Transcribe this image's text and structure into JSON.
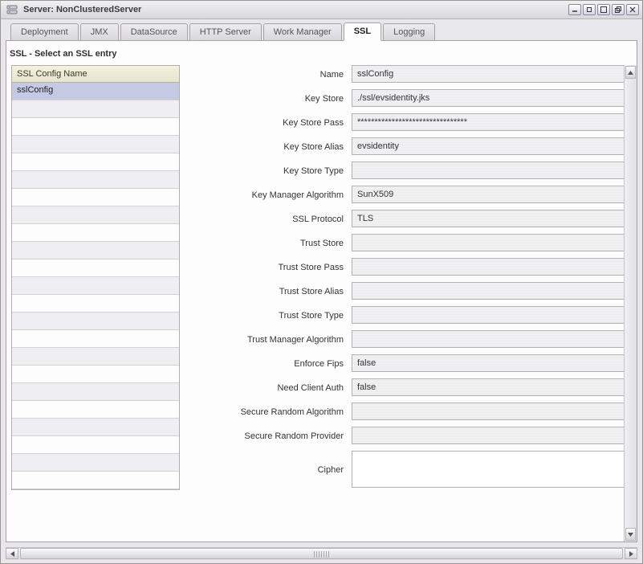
{
  "window": {
    "title": "Server: NonClusteredServer"
  },
  "tabs": [
    {
      "label": "Deployment",
      "active": false
    },
    {
      "label": "JMX",
      "active": false
    },
    {
      "label": "DataSource",
      "active": false
    },
    {
      "label": "HTTP Server",
      "active": false
    },
    {
      "label": "Work Manager",
      "active": false
    },
    {
      "label": "SSL",
      "active": true
    },
    {
      "label": "Logging",
      "active": false
    }
  ],
  "section": {
    "title": "SSL - Select an SSL entry"
  },
  "list": {
    "header": "SSL Config Name",
    "items": [
      "sslConfig"
    ],
    "selected_index": 0,
    "visible_rows": 23
  },
  "form": {
    "fields": [
      {
        "label": "Name",
        "value": "sslConfig",
        "type": "text"
      },
      {
        "label": "Key Store",
        "value": "./ssl/evsidentity.jks",
        "type": "text"
      },
      {
        "label": "Key Store Pass",
        "value": "********************************",
        "type": "text"
      },
      {
        "label": "Key Store Alias",
        "value": "evsidentity",
        "type": "text"
      },
      {
        "label": "Key Store Type",
        "value": "",
        "type": "text"
      },
      {
        "label": "Key Manager Algorithm",
        "value": "SunX509",
        "type": "text"
      },
      {
        "label": "SSL Protocol",
        "value": "TLS",
        "type": "text"
      },
      {
        "label": "Trust Store",
        "value": "",
        "type": "text"
      },
      {
        "label": "Trust Store Pass",
        "value": "",
        "type": "text"
      },
      {
        "label": "Trust Store Alias",
        "value": "",
        "type": "text"
      },
      {
        "label": "Trust Store Type",
        "value": "",
        "type": "text"
      },
      {
        "label": "Trust Manager Algorithm",
        "value": "",
        "type": "text"
      },
      {
        "label": "Enforce Fips",
        "value": "false",
        "type": "text"
      },
      {
        "label": "Need Client Auth",
        "value": "false",
        "type": "text"
      },
      {
        "label": "Secure Random Algorithm",
        "value": "",
        "type": "text"
      },
      {
        "label": "Secure Random Provider",
        "value": "",
        "type": "text"
      },
      {
        "label": "Cipher",
        "value": "",
        "type": "textarea"
      }
    ]
  }
}
